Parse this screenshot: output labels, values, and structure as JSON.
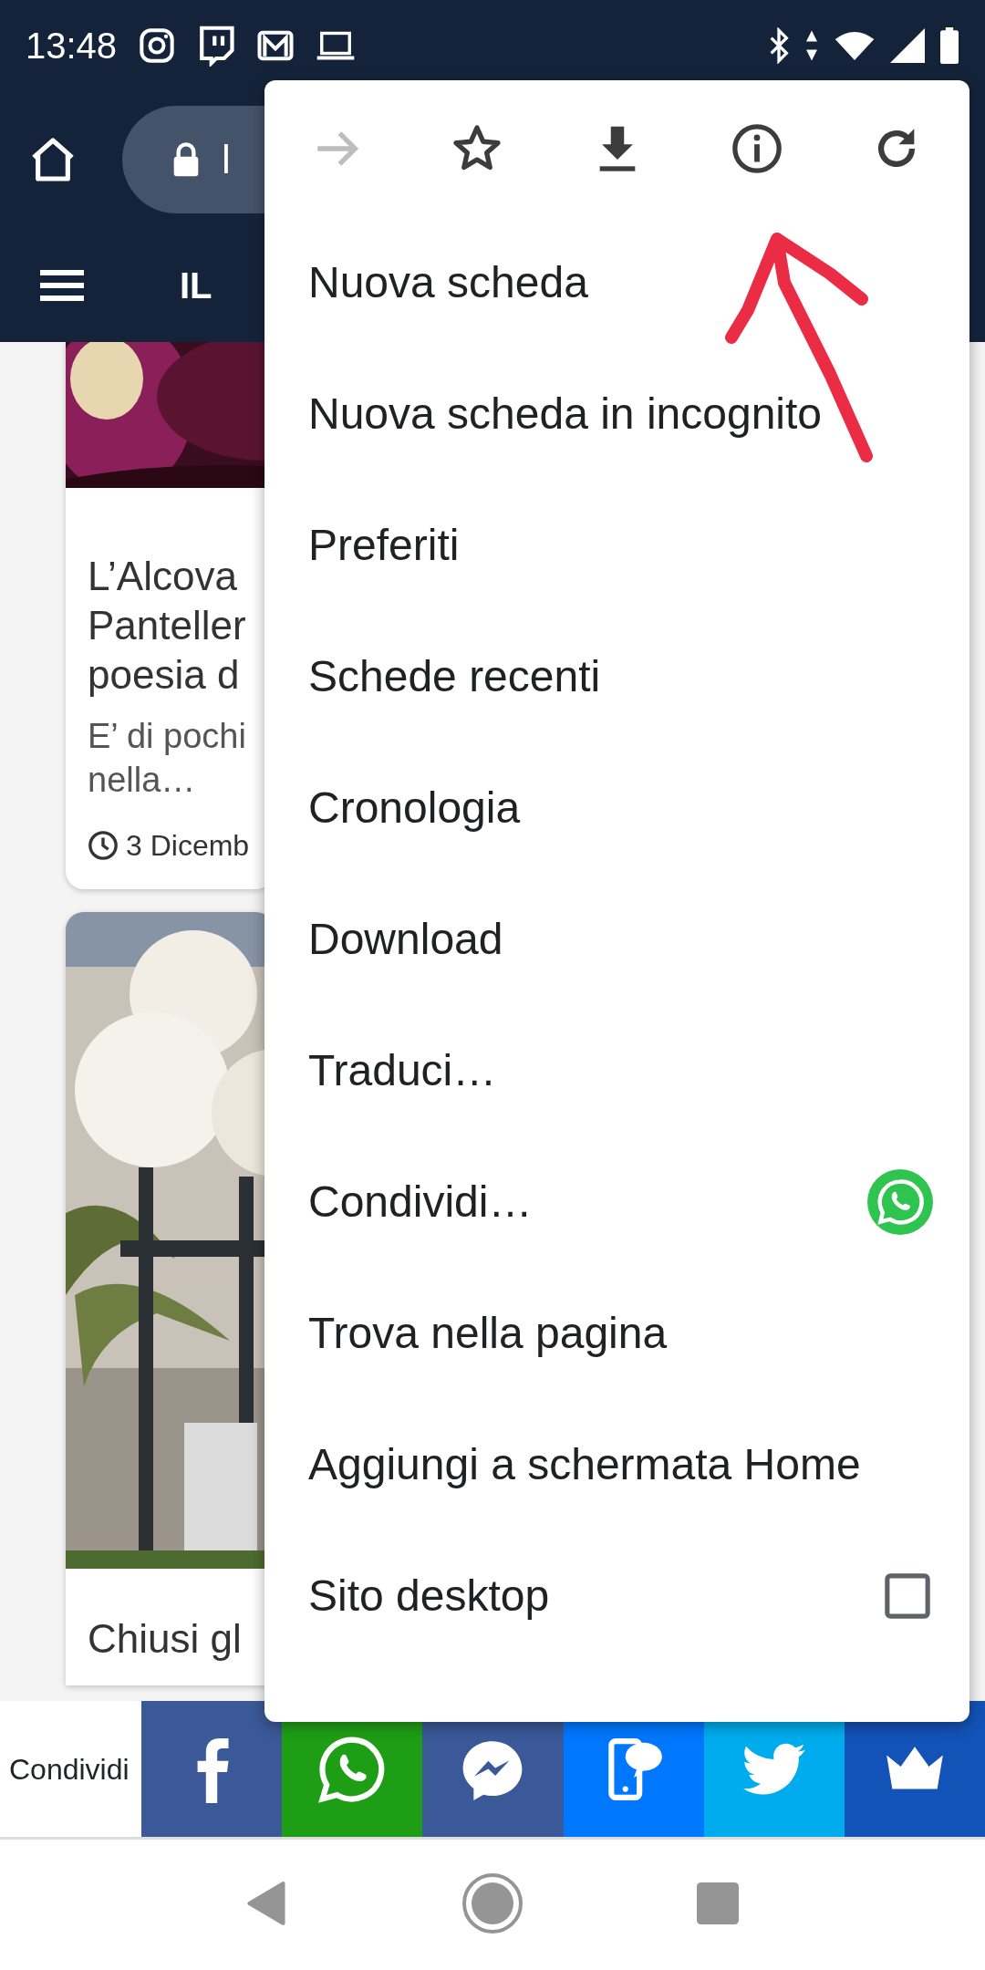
{
  "status_bar": {
    "time": "13:48"
  },
  "toolbar": {
    "url": "l"
  },
  "site_header": {
    "title": "IL"
  },
  "articles": [
    {
      "title_lines": [
        "L’Alcova",
        "Panteller",
        "poesia d"
      ],
      "excerpt_lines": [
        "E’ di pochi",
        "nella…"
      ],
      "date": "3 Dicemb"
    },
    {
      "title_lines": [
        "Chiusi gl"
      ]
    }
  ],
  "menu": {
    "actions": [
      {
        "kind": "forward",
        "disabled": true
      },
      {
        "kind": "bookmark",
        "disabled": false
      },
      {
        "kind": "download",
        "disabled": false
      },
      {
        "kind": "info",
        "disabled": false
      },
      {
        "kind": "reload",
        "disabled": false
      }
    ],
    "items": [
      {
        "label": "Nuova scheda",
        "kind": "plain"
      },
      {
        "label": "Nuova scheda in incognito",
        "kind": "plain"
      },
      {
        "label": "Preferiti",
        "kind": "plain"
      },
      {
        "label": "Schede recenti",
        "kind": "plain"
      },
      {
        "label": "Cronologia",
        "kind": "plain"
      },
      {
        "label": "Download",
        "kind": "plain"
      },
      {
        "label": "Traduci…",
        "kind": "plain"
      },
      {
        "label": "Condividi…",
        "kind": "share"
      },
      {
        "label": "Trova nella pagina",
        "kind": "plain"
      },
      {
        "label": "Aggiungi a schermata Home",
        "kind": "plain"
      },
      {
        "label": "Sito desktop",
        "kind": "checkbox",
        "checked": false
      }
    ]
  },
  "share_bar": {
    "label": "Condividi",
    "buttons": [
      {
        "kind": "facebook",
        "color": "#3b5998"
      },
      {
        "kind": "whatsapp",
        "color": "#1e9e14"
      },
      {
        "kind": "messenger",
        "color": "#3b5998"
      },
      {
        "kind": "sms",
        "color": "#0077ff"
      },
      {
        "kind": "twitter",
        "color": "#00aced"
      },
      {
        "kind": "crown",
        "color": "#1352b6"
      }
    ]
  }
}
